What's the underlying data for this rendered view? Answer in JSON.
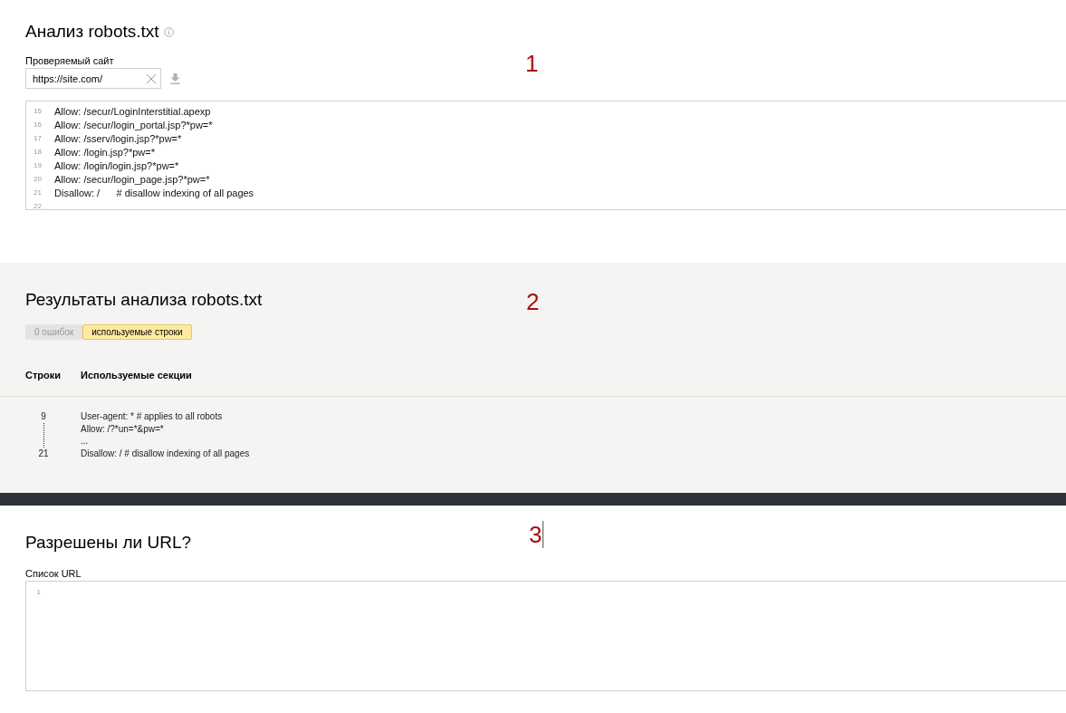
{
  "analysis": {
    "title": "Анализ robots.txt",
    "marker": {
      "text": "1",
      "caret": false
    },
    "site_field": {
      "label": "Проверяемый сайт",
      "value": "https://site.com/"
    },
    "editor": {
      "lines": [
        {
          "number": "15",
          "text": "Allow: /secur/LoginInterstitial.apexp"
        },
        {
          "number": "16",
          "text": "Allow: /secur/login_portal.jsp?*pw=*"
        },
        {
          "number": "17",
          "text": "Allow: /sserv/login.jsp?*pw=*"
        },
        {
          "number": "18",
          "text": "Allow: /login.jsp?*pw=*"
        },
        {
          "number": "19",
          "text": "Allow: /login/login.jsp?*pw=*"
        },
        {
          "number": "20",
          "text": "Allow: /secur/login_page.jsp?*pw=*"
        },
        {
          "number": "21",
          "text": "Disallow: /      # disallow indexing of all pages"
        },
        {
          "number": "22"
        }
      ]
    }
  },
  "results": {
    "title": "Результаты анализа robots.txt",
    "marker": {
      "text": "2",
      "caret": false
    },
    "tabs": [
      {
        "label": "0 ошибок",
        "selected": false
      },
      {
        "label": "используемые строки",
        "selected": true
      }
    ],
    "table": {
      "columns": [
        "Строки",
        "Используемые секции"
      ],
      "rows": [
        {
          "first_line": "9",
          "last_line": "21",
          "lines": [
            "User-agent: * # applies to all robots",
            "Allow: /?*un=*&pw=*",
            "...",
            "Disallow: / # disallow indexing of all pages"
          ]
        }
      ]
    }
  },
  "url_check": {
    "title": "Разрешены ли URL?",
    "marker": {
      "text": "3",
      "caret": true
    },
    "list_field": {
      "label": "Список URL",
      "line_numbers": [
        "1"
      ]
    }
  }
}
